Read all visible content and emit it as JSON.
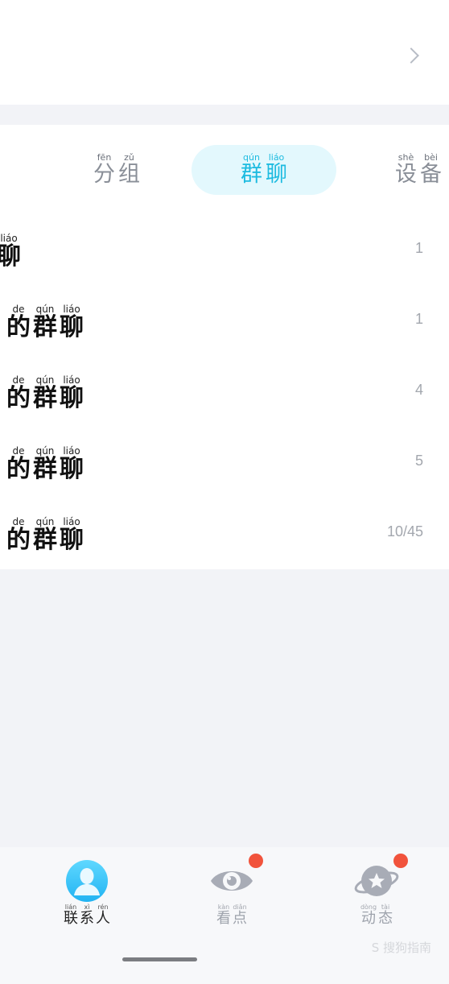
{
  "tabs": [
    {
      "chars": [
        {
          "py": "fēn",
          "hz": "分"
        },
        {
          "py": "zǔ",
          "hz": "组"
        }
      ],
      "active": false
    },
    {
      "chars": [
        {
          "py": "qún",
          "hz": "群"
        },
        {
          "py": "liáo",
          "hz": "聊"
        }
      ],
      "active": true
    },
    {
      "chars": [
        {
          "py": "shè",
          "hz": "设"
        },
        {
          "py": "bèi",
          "hz": "备"
        }
      ],
      "active": false
    }
  ],
  "groups": [
    {
      "chars": [
        {
          "py": "liáo",
          "hz": "聊"
        }
      ],
      "count": "1"
    },
    {
      "chars": [
        {
          "py": "de",
          "hz": "的"
        },
        {
          "py": "qún",
          "hz": "群"
        },
        {
          "py": "liáo",
          "hz": "聊"
        }
      ],
      "count": "1"
    },
    {
      "chars": [
        {
          "py": "de",
          "hz": "的"
        },
        {
          "py": "qún",
          "hz": "群"
        },
        {
          "py": "liáo",
          "hz": "聊"
        }
      ],
      "count": "4"
    },
    {
      "chars": [
        {
          "py": "de",
          "hz": "的"
        },
        {
          "py": "qún",
          "hz": "群"
        },
        {
          "py": "liáo",
          "hz": "聊"
        }
      ],
      "count": "5"
    },
    {
      "chars": [
        {
          "py": "de",
          "hz": "的"
        },
        {
          "py": "qún",
          "hz": "群"
        },
        {
          "py": "liáo",
          "hz": "聊"
        }
      ],
      "count": "10/45"
    }
  ],
  "nav": [
    {
      "icon": "contacts-avatar-icon",
      "chars": [
        {
          "py": "lián",
          "hz": "联"
        },
        {
          "py": "xì",
          "hz": "系"
        },
        {
          "py": "rén",
          "hz": "人"
        }
      ],
      "active": true,
      "badge": false
    },
    {
      "icon": "eye-icon",
      "chars": [
        {
          "py": "kàn",
          "hz": "看"
        },
        {
          "py": "diǎn",
          "hz": "点"
        }
      ],
      "active": false,
      "badge": true
    },
    {
      "icon": "planet-star-icon",
      "chars": [
        {
          "py": "dòng",
          "hz": "动"
        },
        {
          "py": "tài",
          "hz": "态"
        }
      ],
      "active": false,
      "badge": true
    }
  ],
  "watermark": "S 搜狗指南",
  "colors": {
    "accent": "#1dbbe0",
    "active_tab_bg": "#e3f8fd",
    "badge": "#f1533c",
    "background": "#f2f3f7"
  }
}
